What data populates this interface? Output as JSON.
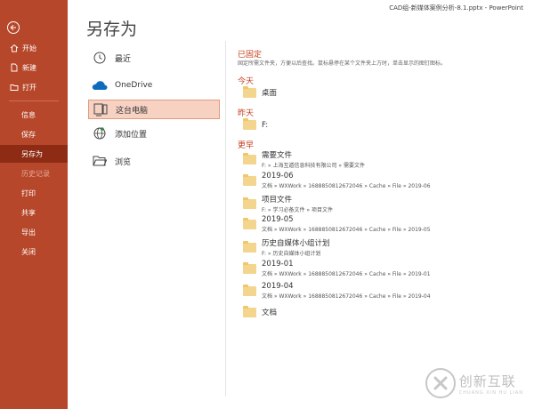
{
  "window": {
    "title": "CAD组-新媒体案例分析-8.1.pptx  -  PowerPoint"
  },
  "page": {
    "title": "另存为"
  },
  "sidebar": {
    "items": [
      {
        "label": "开始",
        "icon": "home-icon"
      },
      {
        "label": "新建",
        "icon": "new-file-icon"
      },
      {
        "label": "打开",
        "icon": "open-folder-icon"
      },
      {
        "label": "信息"
      },
      {
        "label": "保存"
      },
      {
        "label": "另存为"
      },
      {
        "label": "历史记录"
      },
      {
        "label": "打印"
      },
      {
        "label": "共享"
      },
      {
        "label": "导出"
      },
      {
        "label": "关闭"
      }
    ]
  },
  "locations": [
    {
      "label": "最近",
      "icon": "clock-icon"
    },
    {
      "label": "OneDrive",
      "icon": "cloud-icon"
    },
    {
      "label": "这台电脑",
      "icon": "computer-icon"
    },
    {
      "label": "添加位置",
      "icon": "globe-add-icon"
    },
    {
      "label": "浏览",
      "icon": "folder-open-icon"
    }
  ],
  "pinned": {
    "title": "已固定",
    "description": "固定所需文件夹，方便以后查找。鼠标悬停在某个文件夹上方时，单击显示的图钉图标。"
  },
  "today": {
    "title": "今天",
    "folders": [
      {
        "name": "桌面"
      }
    ]
  },
  "yesterday": {
    "title": "昨天",
    "folders": [
      {
        "name": "F:"
      }
    ]
  },
  "older": {
    "title": "更早",
    "folders": [
      {
        "name": "需要文件",
        "path": "F: » 上海互遁信息科技有限公司 » 需要文件"
      },
      {
        "name": "2019-06",
        "path": "文档 » WXWork » 1688850812672046 » Cache » File » 2019-06"
      },
      {
        "name": "项目文件",
        "path": "F: » 学习必备文件 » 项目文件"
      },
      {
        "name": "2019-05",
        "path": "文档 » WXWork » 1688850812672046 » Cache » File » 2019-05"
      },
      {
        "name": "历史自媒体小组计划",
        "path": "F: » 历史自媒体小组计划"
      },
      {
        "name": "2019-01",
        "path": "文档 » WXWork » 1688850812672046 » Cache » File » 2019-01"
      },
      {
        "name": "2019-04",
        "path": "文档 » WXWork » 1688850812672046 » Cache » File » 2019-04"
      },
      {
        "name": "文档"
      }
    ]
  },
  "watermark": {
    "cn": "创新互联",
    "en": "CHUANG XIN HU LIAN"
  },
  "colors": {
    "sidebar": "#b7472a",
    "active": "#8e2b14",
    "accent": "#c43e1c",
    "selected": "#f7d2c3",
    "folder": "#f4d58d"
  }
}
